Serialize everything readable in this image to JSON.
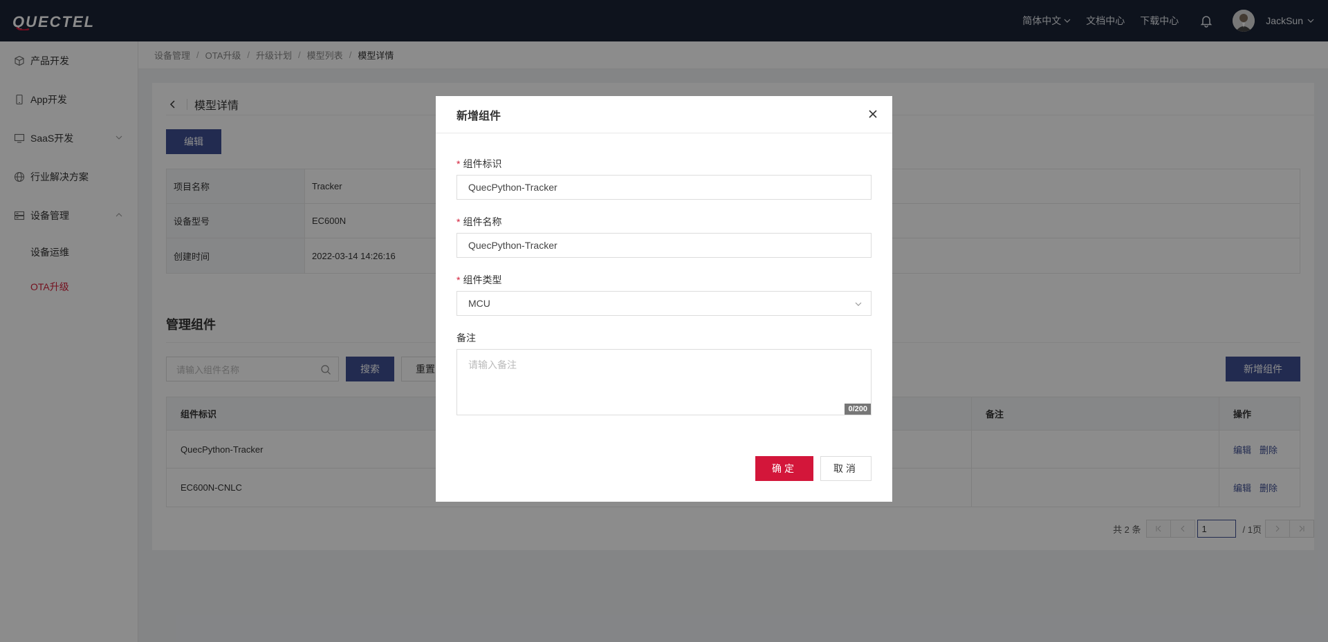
{
  "brand": {
    "logo_text": "QUECTEL",
    "logo_color": "#ffffff",
    "accent_red": "#d3163a",
    "primary_blue": "#3f4f93"
  },
  "navbar": {
    "language": "简体中文",
    "docs": "文档中心",
    "downloads": "下载中心",
    "user_name": "JackSun"
  },
  "sidebar": {
    "items": [
      {
        "label": "产品开发",
        "icon": "cube-icon"
      },
      {
        "label": "App开发",
        "icon": "phone-icon"
      },
      {
        "label": "SaaS开发",
        "icon": "monitor-icon"
      },
      {
        "label": "行业解决方案",
        "icon": "globe-icon"
      },
      {
        "label": "设备管理",
        "icon": "server-icon"
      }
    ],
    "sub_items": [
      {
        "label": "设备运维"
      },
      {
        "label": "OTA升级"
      }
    ]
  },
  "breadcrumb": [
    "设备管理",
    "OTA升级",
    "升级计划",
    "模型列表",
    "模型详情"
  ],
  "detail": {
    "title": "模型详情",
    "edit_label": "编辑",
    "rows": [
      {
        "label": "项目名称",
        "value": "Tracker"
      },
      {
        "label": "设备型号",
        "value": "EC600N"
      },
      {
        "label": "创建时间",
        "value": "2022-03-14 14:26:16"
      }
    ]
  },
  "components": {
    "section_title": "管理组件",
    "search_placeholder": "请输入组件名称",
    "search_label": "搜索",
    "reset_label": "重置",
    "add_label": "新增组件",
    "columns": {
      "id": "组件标识",
      "remark": "备注",
      "ops": "操作"
    },
    "rows": [
      {
        "id": "QuecPython-Tracker",
        "remark": "",
        "edit": "编辑",
        "delete": "删除"
      },
      {
        "id": "EC600N-CNLC",
        "remark": "",
        "edit": "编辑",
        "delete": "删除"
      }
    ],
    "pager": {
      "total": "共 2 条",
      "current_page": "1",
      "pages": "/ 1页"
    }
  },
  "modal": {
    "title": "新增组件",
    "fields": {
      "id_label": "组件标识",
      "id_value": "QuecPython-Tracker",
      "name_label": "组件名称",
      "name_value": "QuecPython-Tracker",
      "type_label": "组件类型",
      "type_value": "MCU",
      "remark_label": "备注",
      "remark_placeholder": "请输入备注",
      "remark_counter": "0/200"
    },
    "ok_label": "确定",
    "cancel_label": "取消"
  }
}
